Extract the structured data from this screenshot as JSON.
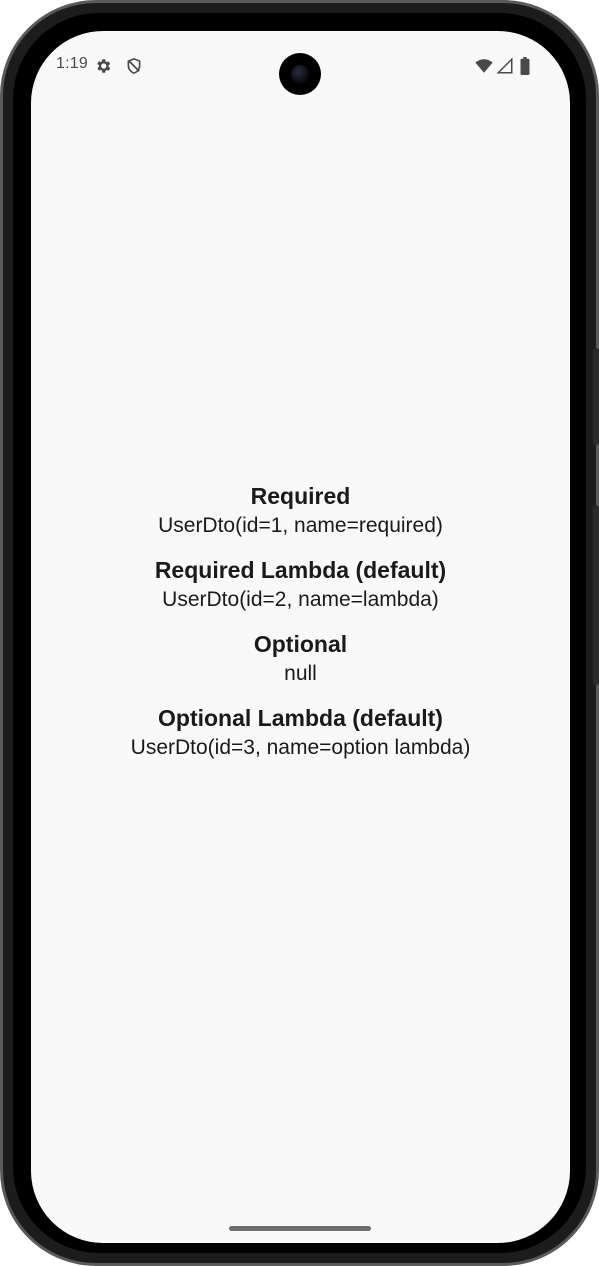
{
  "status_bar": {
    "time": "1:19",
    "icons": [
      "settings-gear-icon",
      "shield-icon",
      "wifi-icon",
      "cellular-signal-icon",
      "battery-icon"
    ]
  },
  "main": {
    "items": [
      {
        "title": "Required",
        "value": "UserDto(id=1, name=required)"
      },
      {
        "title": "Required Lambda (default)",
        "value": "UserDto(id=2, name=lambda)"
      },
      {
        "title": "Optional",
        "value": "null"
      },
      {
        "title": "Optional Lambda (default)",
        "value": "UserDto(id=3, name=option lambda)"
      }
    ]
  },
  "colors": {
    "screen_background": "#f9f9f9",
    "text": "#1a1a1a",
    "status_text": "#4a4a4a"
  }
}
